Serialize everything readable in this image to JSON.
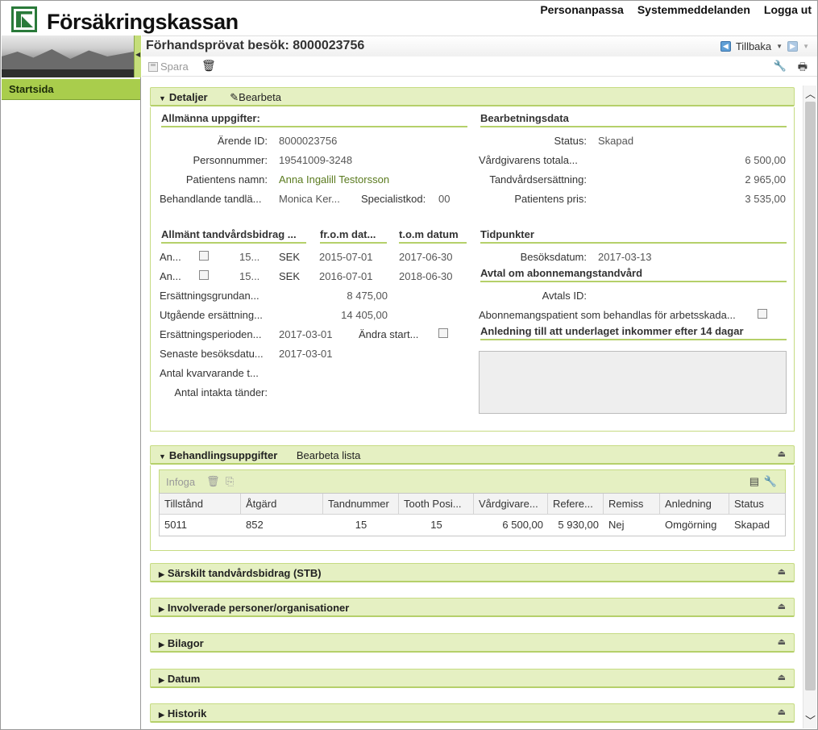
{
  "app": {
    "logo_text": "Försäkringskassan",
    "top_links": [
      "Personanpassa",
      "Systemmeddelanden",
      "Logga ut"
    ]
  },
  "sidebar": {
    "items": [
      "Startsida"
    ]
  },
  "page": {
    "title": "Förhandsprövat besök: 8000023756",
    "back_label": "Tillbaka"
  },
  "toolbar": {
    "save_label": "Spara"
  },
  "detaljer": {
    "title": "Detaljer",
    "edit_label": "Bearbeta",
    "allmanna": {
      "heading": "Allmänna uppgifter:",
      "arende_label": "Ärende ID:",
      "arende_value": "8000023756",
      "personnr_label": "Personnummer:",
      "personnr_value": "19541009-3248",
      "patient_label": "Patientens namn:",
      "patient_value": "Anna Ingalill Testorsson",
      "tandlakare_label": "Behandlande tandlä...",
      "tandlakare_value": "Monica Ker...",
      "specialist_label": "Specialistkod:",
      "specialist_value": "00"
    },
    "bearbetning": {
      "heading": "Bearbetningsdata",
      "status_label": "Status:",
      "status_value": "Skapad",
      "total_label": "Vårdgivarens totala...",
      "total_value": "6 500,00",
      "ersattning_label": "Tandvårdsersättning:",
      "ersattning_value": "2 965,00",
      "pris_label": "Patientens pris:",
      "pris_value": "3 535,00"
    },
    "atb": {
      "heading": "Allmänt tandvårdsbidrag ...",
      "from_heading": "fr.o.m dat...",
      "tom_heading": "t.o.m datum",
      "rows": [
        {
          "label": "An...",
          "amount": "15...",
          "currency": "SEK",
          "from": "2015-07-01",
          "tom": "2017-06-30"
        },
        {
          "label": "An...",
          "amount": "15...",
          "currency": "SEK",
          "from": "2016-07-01",
          "tom": "2018-06-30"
        }
      ],
      "grund_label": "Ersättningsgrundan...",
      "grund_value": "8 475,00",
      "utgaende_label": "Utgående ersättning...",
      "utgaende_value": "14 405,00",
      "period_label": "Ersättningsperioden...",
      "period_value": "2017-03-01",
      "andra_label": "Ändra start...",
      "senaste_label": "Senaste besöksdatu...",
      "senaste_value": "2017-03-01",
      "kvar_label": "Antal kvarvarande t...",
      "intakta_label": "Antal intakta tänder:"
    },
    "tidpunkter": {
      "heading": "Tidpunkter",
      "besok_label": "Besöksdatum:",
      "besok_value": "2017-03-13"
    },
    "avtal": {
      "heading": "Avtal om abonnemangstandvård",
      "id_label": "Avtals ID:",
      "abonnemang_label": "Abonnemangspatient som behandlas för arbetsskada..."
    },
    "anledning": {
      "heading": "Anledning till att underlaget inkommer efter 14 dagar"
    }
  },
  "behandling": {
    "title": "Behandlingsuppgifter",
    "list_label": "Bearbeta lista",
    "infoga_label": "Infoga",
    "columns": [
      "Tillstånd",
      "Åtgärd",
      "Tandnummer",
      "Tooth Posi...",
      "Vårdgivare...",
      "Refere...",
      "Remiss",
      "Anledning",
      "Status"
    ],
    "rows": [
      [
        "5011",
        "852",
        "15",
        "15",
        "6 500,00",
        "5 930,00",
        "Nej",
        "Omgörning",
        "Skapad"
      ]
    ]
  },
  "collapsed_panels": [
    "Särskilt tandvårdsbidrag (STB)",
    "Involverade personer/organisationer",
    "Bilagor",
    "Datum",
    "Historik"
  ]
}
